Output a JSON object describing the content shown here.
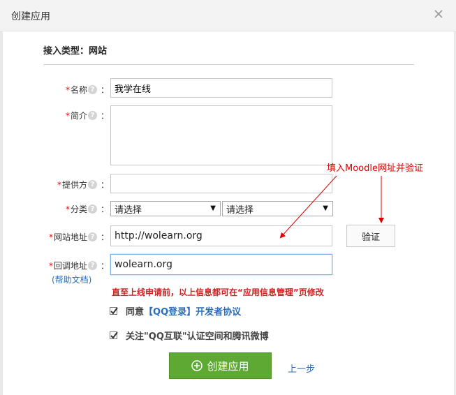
{
  "dialog": {
    "title": "创建应用",
    "section_title": "接入类型：网站"
  },
  "form": {
    "name": {
      "label": "名称",
      "value": "我学在线"
    },
    "intro": {
      "label": "简介",
      "value": ""
    },
    "provider": {
      "label": "提供方",
      "value": ""
    },
    "category": {
      "label": "分类",
      "select1": "请选择",
      "select2": "请选择"
    },
    "website": {
      "label": "网站地址",
      "value": "http://wolearn.org"
    },
    "callback": {
      "label": "回调地址",
      "value": "wolearn.org"
    },
    "required_mark": "*",
    "help_mark": "?",
    "colon": "："
  },
  "buttons": {
    "verify": "验证",
    "create": "创建应用",
    "prev": "上一步"
  },
  "help_link": "(帮助文档)",
  "notice": "直至上线申请前，以上信息都可在“应用信息管理”页修改",
  "checks": {
    "agree_prefix": "同意",
    "agree_link": "【QQ登录】开发者协议",
    "follow": "关注\"QQ互联\"认证空间和腾讯微博"
  },
  "annotation": "填入Moodle网址并验证",
  "colors": {
    "accent_green": "#5ea933",
    "link_blue": "#2a6ebb",
    "notice_red": "#d62020",
    "annotation_red": "#dd0000"
  }
}
